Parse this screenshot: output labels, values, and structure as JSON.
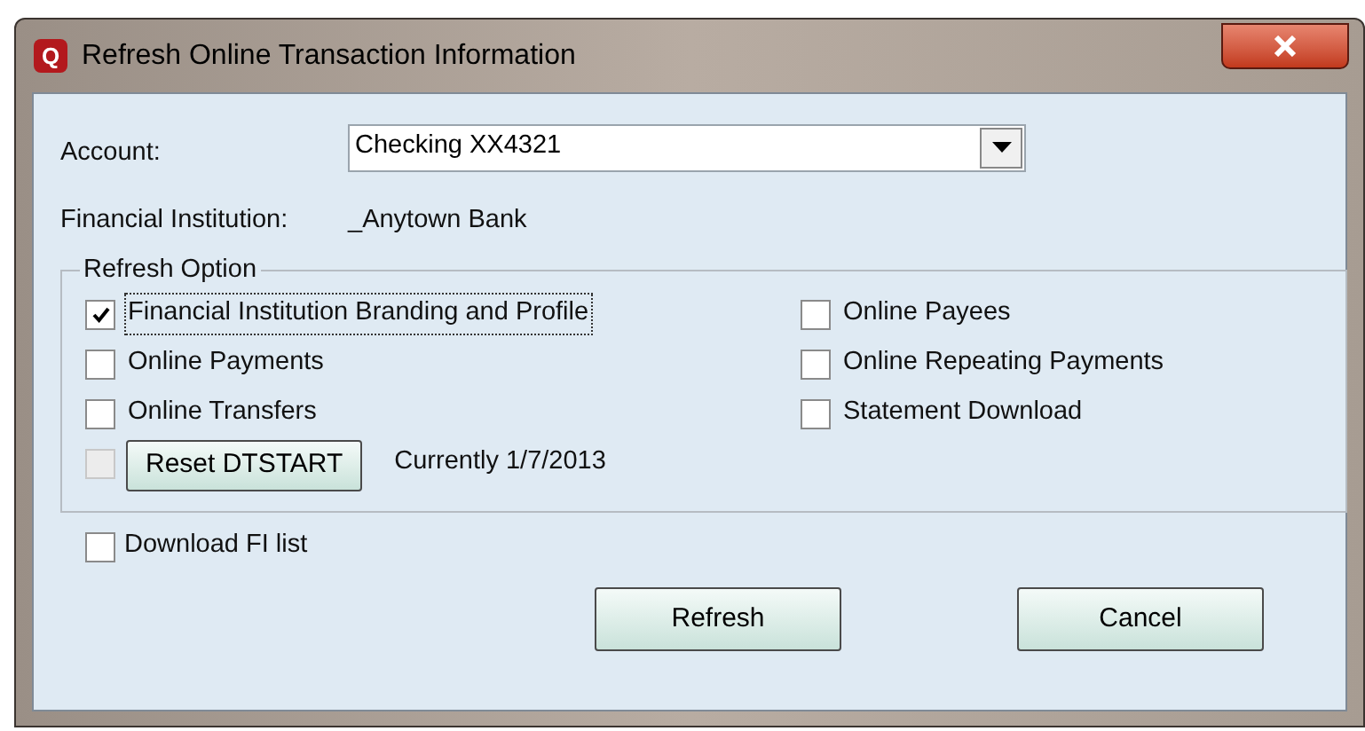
{
  "window": {
    "title": "Refresh Online Transaction Information",
    "app_icon": "Q"
  },
  "account": {
    "label": "Account:",
    "value": "Checking XX4321"
  },
  "institution": {
    "label": "Financial Institution:",
    "value": "_Anytown Bank"
  },
  "refresh_option": {
    "title": "Refresh Option",
    "options": [
      {
        "label": "Financial Institution Branding and Profile",
        "checked": true,
        "focused": true
      },
      {
        "label": "Online Payees",
        "checked": false,
        "focused": false
      },
      {
        "label": "Online Payments",
        "checked": false,
        "focused": false
      },
      {
        "label": "Online Repeating Payments",
        "checked": false,
        "focused": false
      },
      {
        "label": "Online Transfers",
        "checked": false,
        "focused": false
      },
      {
        "label": "Statement Download",
        "checked": false,
        "focused": false
      }
    ],
    "reset": {
      "checked": false,
      "disabled": true,
      "button": "Reset DTSTART",
      "note": "Currently 1/7/2013"
    }
  },
  "download_fi_list": {
    "label": "Download FI list",
    "checked": false
  },
  "buttons": [
    "Refresh",
    "Cancel"
  ]
}
